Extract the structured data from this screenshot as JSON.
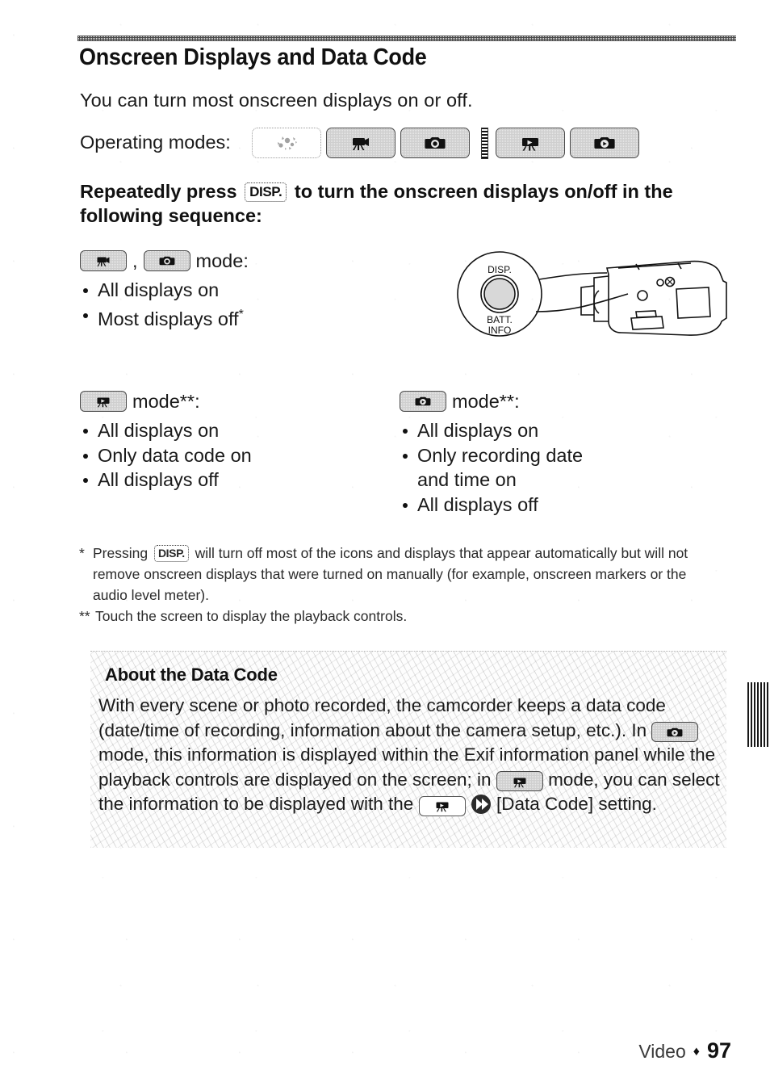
{
  "page": {
    "title": "Onscreen Displays and Data Code",
    "intro": "You can turn most onscreen displays on or off.",
    "operating_modes_label": "Operating modes:",
    "footer_section": "Video",
    "footer_page": "97",
    "footer_separator": "♦"
  },
  "operating_modes": {
    "chips": [
      {
        "icon": "smart-auto-icon",
        "state": "off",
        "name": "mode-chip-smart-auto"
      },
      {
        "icon": "movie-camera-icon",
        "state": "on",
        "name": "mode-chip-movie-record"
      },
      {
        "icon": "photo-camera-icon",
        "state": "on",
        "name": "mode-chip-photo-record"
      },
      {
        "icon": "movie-playback-icon",
        "state": "on",
        "name": "mode-chip-movie-playback"
      },
      {
        "icon": "photo-playback-icon",
        "state": "on",
        "name": "mode-chip-photo-playback"
      }
    ],
    "divider": "film-strip-divider"
  },
  "instruction": {
    "before": "Repeatedly press",
    "badge": "DISP.",
    "after": "to turn the onscreen displays on/off in the following sequence:"
  },
  "record_block": {
    "separator": ",",
    "mode_label": "mode:",
    "items": [
      "All displays on",
      "Most displays off"
    ],
    "footnote_mark": "*"
  },
  "movie_playback_block": {
    "mode_label": "mode**:",
    "items": [
      "All displays on",
      "Only data code on",
      "All displays off"
    ]
  },
  "photo_playback_block": {
    "mode_label": "mode**:",
    "items": [
      "All displays on",
      "Only recording date",
      "and time on",
      "All displays off"
    ]
  },
  "footnotes": {
    "single_mark": "*",
    "single_before": "Pressing",
    "single_badge": "DISP.",
    "single_after": "will turn off most of the icons and displays that appear automatically but will not remove onscreen displays that were turned on manually (for example, onscreen markers or the audio level meter).",
    "double_mark": "**",
    "double_text": "Touch the screen to display the playback controls."
  },
  "about_box": {
    "title": "About the Data Code",
    "part1": "With every scene or photo recorded, the camcorder keeps a data code (date/time of recording, information about the camera setup, etc.). In",
    "part2": "mode, this information is displayed within the Exif information panel while the playback controls are displayed on the screen; in",
    "part3": "mode, you can select the information to be displayed with the",
    "part4": "[Data Code] setting."
  },
  "colors": {
    "text": "#1a1a1a",
    "chip_border": "#4a4a4a",
    "chip_fill": "#eaeaea",
    "page_bg": "#ffffff"
  }
}
